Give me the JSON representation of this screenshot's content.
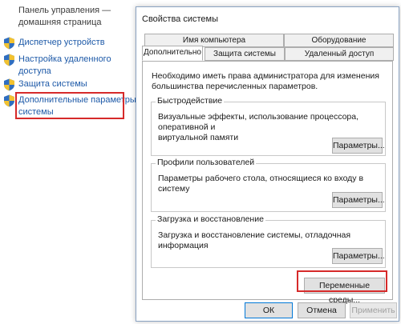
{
  "sidebar": {
    "home_line1": "Панель управления —",
    "home_line2": "домашняя страница",
    "items": [
      {
        "line1": "Диспетчер устройств",
        "line2": ""
      },
      {
        "line1": "Настройка удаленного",
        "line2": "доступа"
      },
      {
        "line1": "Защита системы",
        "line2": ""
      },
      {
        "line1": "Дополнительные параметры",
        "line2": "системы"
      }
    ]
  },
  "dialog": {
    "title": "Свойства системы",
    "tabs_top": [
      "Имя компьютера",
      "Оборудование"
    ],
    "tabs_bottom": [
      "Дополнительно",
      "Защита системы",
      "Удаленный доступ"
    ],
    "admin_note_line1": "Необходимо иметь права администратора для изменения",
    "admin_note_line2": "большинства перечисленных параметров.",
    "groups": {
      "performance": {
        "title": "Быстродействие",
        "text_line1": "Визуальные эффекты, использование процессора, оперативной и",
        "text_line2": "виртуальной памяти",
        "button": "Параметры..."
      },
      "profiles": {
        "title": "Профили пользователей",
        "text_line1": "Параметры рабочего стола, относящиеся ко входу в систему",
        "button": "Параметры..."
      },
      "startup": {
        "title": "Загрузка и восстановление",
        "text_line1": "Загрузка и восстановление системы, отладочная информация",
        "button": "Параметры..."
      }
    },
    "env_button": "Переменные среды...",
    "ok_button": "ОК",
    "cancel_button": "Отмена",
    "apply_button": "Применить"
  },
  "colors": {
    "link": "#1e5aa8",
    "highlight": "#d62a2a",
    "shield_blue": "#2f6ec0",
    "shield_yellow": "#f2c230"
  }
}
